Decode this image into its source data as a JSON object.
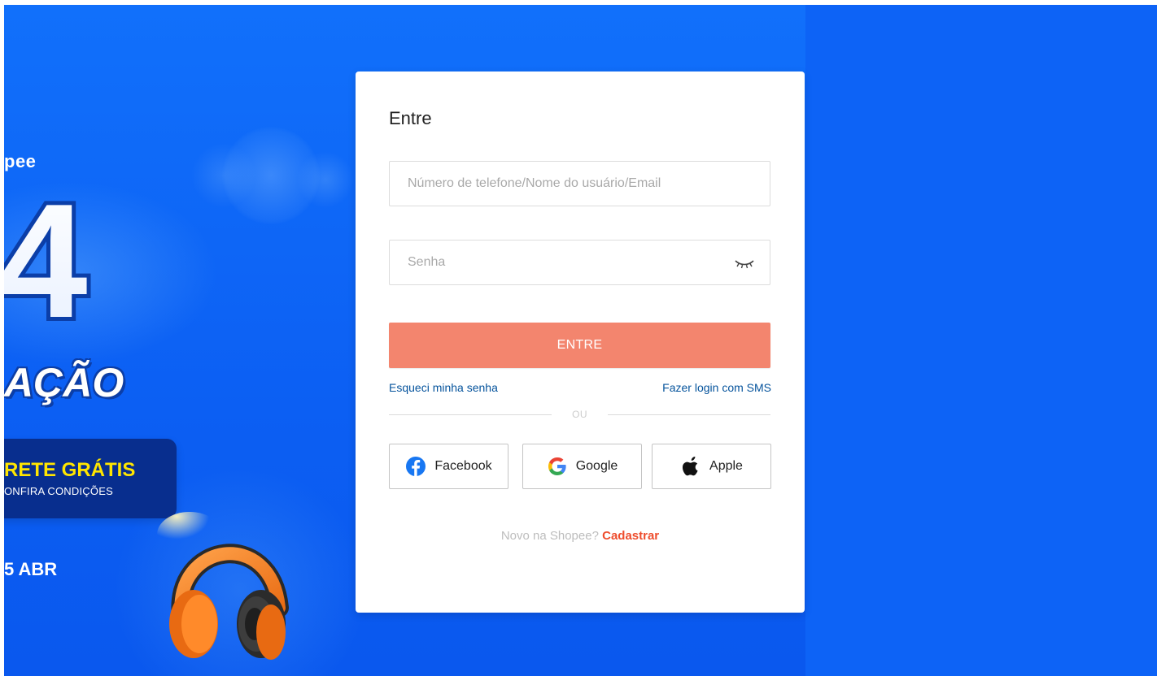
{
  "banner": {
    "brand_fragment": "pee",
    "big_number": "4",
    "word_fragment": "AÇÃO",
    "frete_title": "RETE GRÁTIS",
    "frete_subtitle": "ONFIRA CONDIÇÕES",
    "date_fragment": "5 ABR"
  },
  "login": {
    "title": "Entre",
    "username_placeholder": "Número de telefone/Nome do usuário/Email",
    "password_placeholder": "Senha",
    "submit_label": "ENTRE",
    "forgot_password": "Esqueci minha senha",
    "sms_login": "Fazer login com SMS",
    "divider_text": "OU",
    "social": {
      "facebook": "Facebook",
      "google": "Google",
      "apple": "Apple"
    },
    "signup_prompt": "Novo na Shopee?",
    "signup_link": "Cadastrar"
  },
  "colors": {
    "background_blue": "#0d63f6",
    "primary_button": "#f3856e",
    "link_blue": "#05539c",
    "signup_orange": "#ee4d2d",
    "frete_yellow": "#ffe600"
  }
}
